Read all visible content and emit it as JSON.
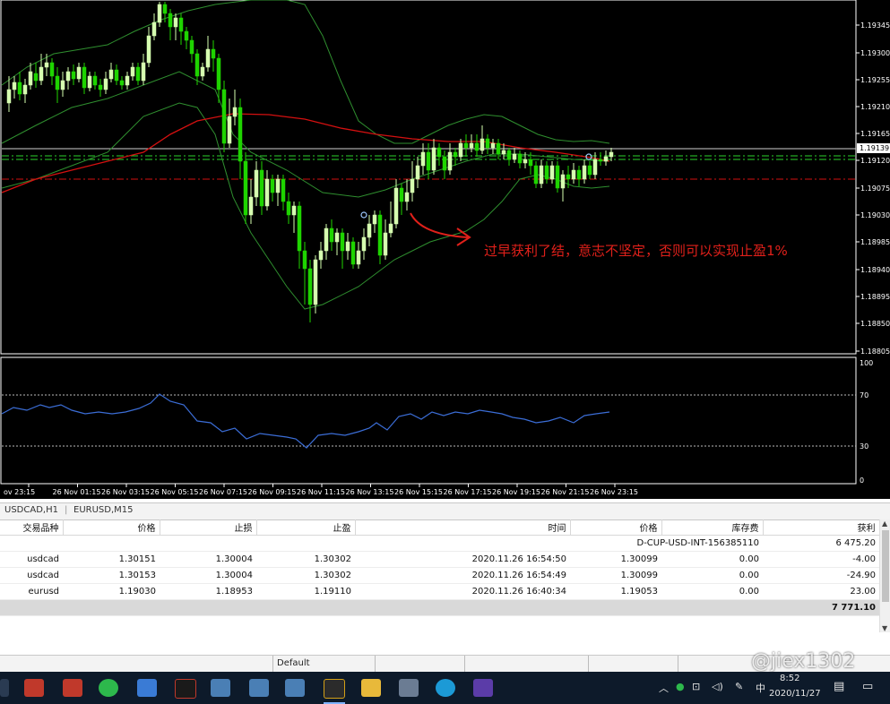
{
  "price_axis": [
    "1.19345",
    "1.19300",
    "1.19255",
    "1.19210",
    "1.19165",
    "1.19120",
    "1.19075",
    "1.19030",
    "1.18985",
    "1.18940",
    "1.18895",
    "1.18850",
    "1.18805"
  ],
  "current_price": "1.19139",
  "rsi_axis": [
    "100",
    "70",
    "30",
    "0"
  ],
  "time_axis": [
    "ov 23:15",
    "26 Nov 01:15",
    "26 Nov 03:15",
    "26 Nov 05:15",
    "26 Nov 07:15",
    "26 Nov 09:15",
    "26 Nov 11:15",
    "26 Nov 13:15",
    "26 Nov 15:15",
    "26 Nov 17:15",
    "26 Nov 19:15",
    "26 Nov 21:15",
    "26 Nov 23:15"
  ],
  "annotation": "过早获利了结，意志不坚定，否则可以实现止盈1%",
  "chart_tabs": [
    "USDCAD,H1",
    "EURUSD,M15"
  ],
  "table": {
    "headers": {
      "symbol": "交易品种",
      "price": "价格",
      "sl": "止损",
      "tp": "止盈",
      "time": "时间",
      "cur_price": "价格",
      "swap": "库存费",
      "profit": "获利"
    },
    "account": {
      "id": "D-CUP-USD-INT-156385110",
      "value": "6 475.20"
    },
    "rows": [
      {
        "symbol": "usdcad",
        "price": "1.30151",
        "sl": "1.30004",
        "tp": "1.30302",
        "time": "2020.11.26 16:54:50",
        "cur_price": "1.30099",
        "swap": "0.00",
        "profit": "-4.00"
      },
      {
        "symbol": "usdcad",
        "price": "1.30153",
        "sl": "1.30004",
        "tp": "1.30302",
        "time": "2020.11.26 16:54:49",
        "cur_price": "1.30099",
        "swap": "0.00",
        "profit": "-24.90"
      },
      {
        "symbol": "eurusd",
        "price": "1.19030",
        "sl": "1.18953",
        "tp": "1.19110",
        "time": "2020.11.26 16:40:34",
        "cur_price": "1.19053",
        "swap": "0.00",
        "profit": "23.00"
      }
    ],
    "total": "7 771.10"
  },
  "status": {
    "profile": "Default"
  },
  "taskbar": {
    "ime": "中",
    "time": "8:52",
    "date": "2020/11/27"
  },
  "watermark": "@jiex1302",
  "colors": {
    "bull": "#d6ffb0",
    "bear": "#1fd400",
    "ma_red": "#d41010",
    "band": "#2f8f2f",
    "rsi": "#3b6dd6",
    "annotation": "#e0201a"
  }
}
